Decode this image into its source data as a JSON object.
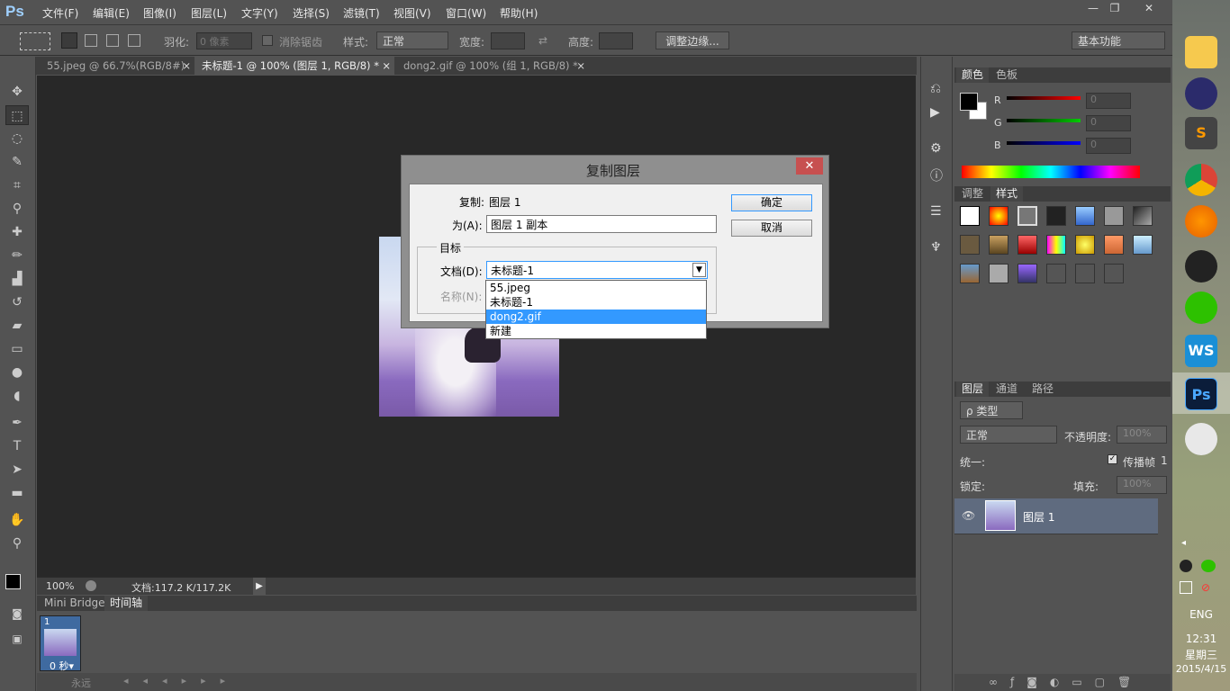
{
  "app": {
    "logo": "Ps"
  },
  "menu": [
    "文件(F)",
    "编辑(E)",
    "图像(I)",
    "图层(L)",
    "文字(Y)",
    "选择(S)",
    "滤镜(T)",
    "视图(V)",
    "窗口(W)",
    "帮助(H)"
  ],
  "window_controls": {
    "minimize": "—",
    "restore": "❐",
    "close": "✕"
  },
  "options": {
    "feather_label": "羽化:",
    "feather_placeholder": "0 像素",
    "antialias_label": "消除锯齿",
    "style_label": "样式:",
    "style_value": "正常",
    "width_label": "宽度:",
    "height_label": "高度:",
    "refine_button": "调整边缘...",
    "workspace": "基本功能"
  },
  "tabs": [
    {
      "label": "55.jpeg @ 66.7%(RGB/8#)",
      "close": "×"
    },
    {
      "label": "未标题-1 @ 100% (图层 1, RGB/8) *",
      "close": "×"
    },
    {
      "label": "dong2.gif @ 100% (组 1, RGB/8) *",
      "close": "×"
    }
  ],
  "status": {
    "zoom": "100%",
    "doc": "文档:117.2 K/117.2K"
  },
  "timeline_panel": {
    "tabs": [
      "Mini Bridge",
      "时间轴"
    ],
    "frame_number": "1",
    "frame_delay": "0 秒▾",
    "loop": "永远"
  },
  "color_panel": {
    "tabs": [
      "颜色",
      "色板"
    ],
    "r_label": "R",
    "g_label": "G",
    "b_label": "B",
    "r": "0",
    "g": "0",
    "b": "0"
  },
  "styles_panel": {
    "tabs": [
      "调整",
      "样式"
    ]
  },
  "layers_panel": {
    "tabs": [
      "图层",
      "通道",
      "路径"
    ],
    "filter": "ρ 类型",
    "blend": "正常",
    "opacity_label": "不透明度:",
    "opacity": "100%",
    "unify_label": "统一:",
    "propagate_label": "传播帧",
    "propagate_num": "1",
    "lock_label": "锁定:",
    "fill_label": "填充:",
    "fill": "100%",
    "layer_name": "图层 1"
  },
  "dialog": {
    "title": "复制图层",
    "copy_label": "复制:",
    "copy_value": "图层 1",
    "as_label": "为(A):",
    "as_value": "图层 1 副本",
    "target_group": "目标",
    "doc_label": "文档(D):",
    "doc_value": "未标题-1",
    "name_label": "名称(N):",
    "ok": "确定",
    "cancel": "取消",
    "options": [
      "55.jpeg",
      "未标题-1",
      "dong2.gif",
      "新建"
    ],
    "highlighted_index": 2
  },
  "taskbar": {
    "lang": "ENG",
    "time": "12:31",
    "weekday": "星期三",
    "date": "2015/4/15"
  },
  "colors": {
    "ui_bg": "#535353",
    "canvas_bg": "#282828",
    "accent": "#3399ff"
  }
}
